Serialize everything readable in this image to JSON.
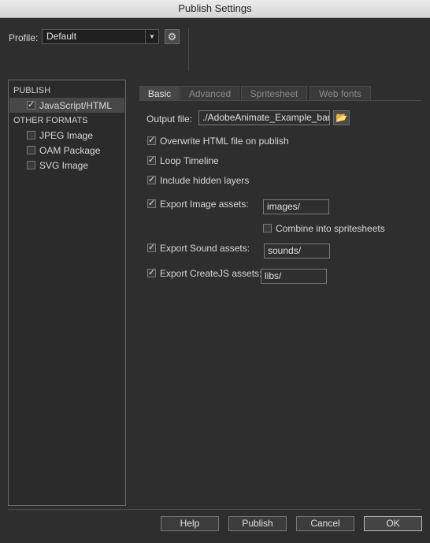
{
  "window": {
    "title": "Publish Settings"
  },
  "profile": {
    "label": "Profile:",
    "value": "Default",
    "arrow_icon": "▼",
    "gear_icon": "⚙"
  },
  "left_panel": {
    "publish_header": "PUBLISH",
    "publish_items": [
      {
        "label": "JavaScript/HTML",
        "checked": true,
        "selected": true
      }
    ],
    "other_header": "OTHER FORMATS",
    "other_items": [
      {
        "label": "JPEG Image",
        "checked": false
      },
      {
        "label": "OAM Package",
        "checked": false
      },
      {
        "label": "SVG Image",
        "checked": false
      }
    ]
  },
  "tabs": [
    {
      "label": "Basic",
      "active": true
    },
    {
      "label": "Advanced",
      "active": false
    },
    {
      "label": "Spritesheet",
      "active": false
    },
    {
      "label": "Web fonts",
      "active": false
    }
  ],
  "basic": {
    "output_label": "Output file:",
    "output_value": "./AdobeAnimate_Example_bar",
    "folder_icon": "📂",
    "overwrite_label": "Overwrite HTML file on publish",
    "loop_label": "Loop Timeline",
    "hidden_layers_label": "Include hidden layers",
    "export_image_label": "Export Image assets:",
    "export_image_value": "images/",
    "combine_label": "Combine into spritesheets",
    "export_sound_label": "Export Sound assets:",
    "export_sound_value": "sounds/",
    "export_createjs_label": "Export CreateJS assets:",
    "export_createjs_value": "libs/",
    "check": "✓"
  },
  "buttons": {
    "help": "Help",
    "publish": "Publish",
    "cancel": "Cancel",
    "ok": "OK"
  }
}
